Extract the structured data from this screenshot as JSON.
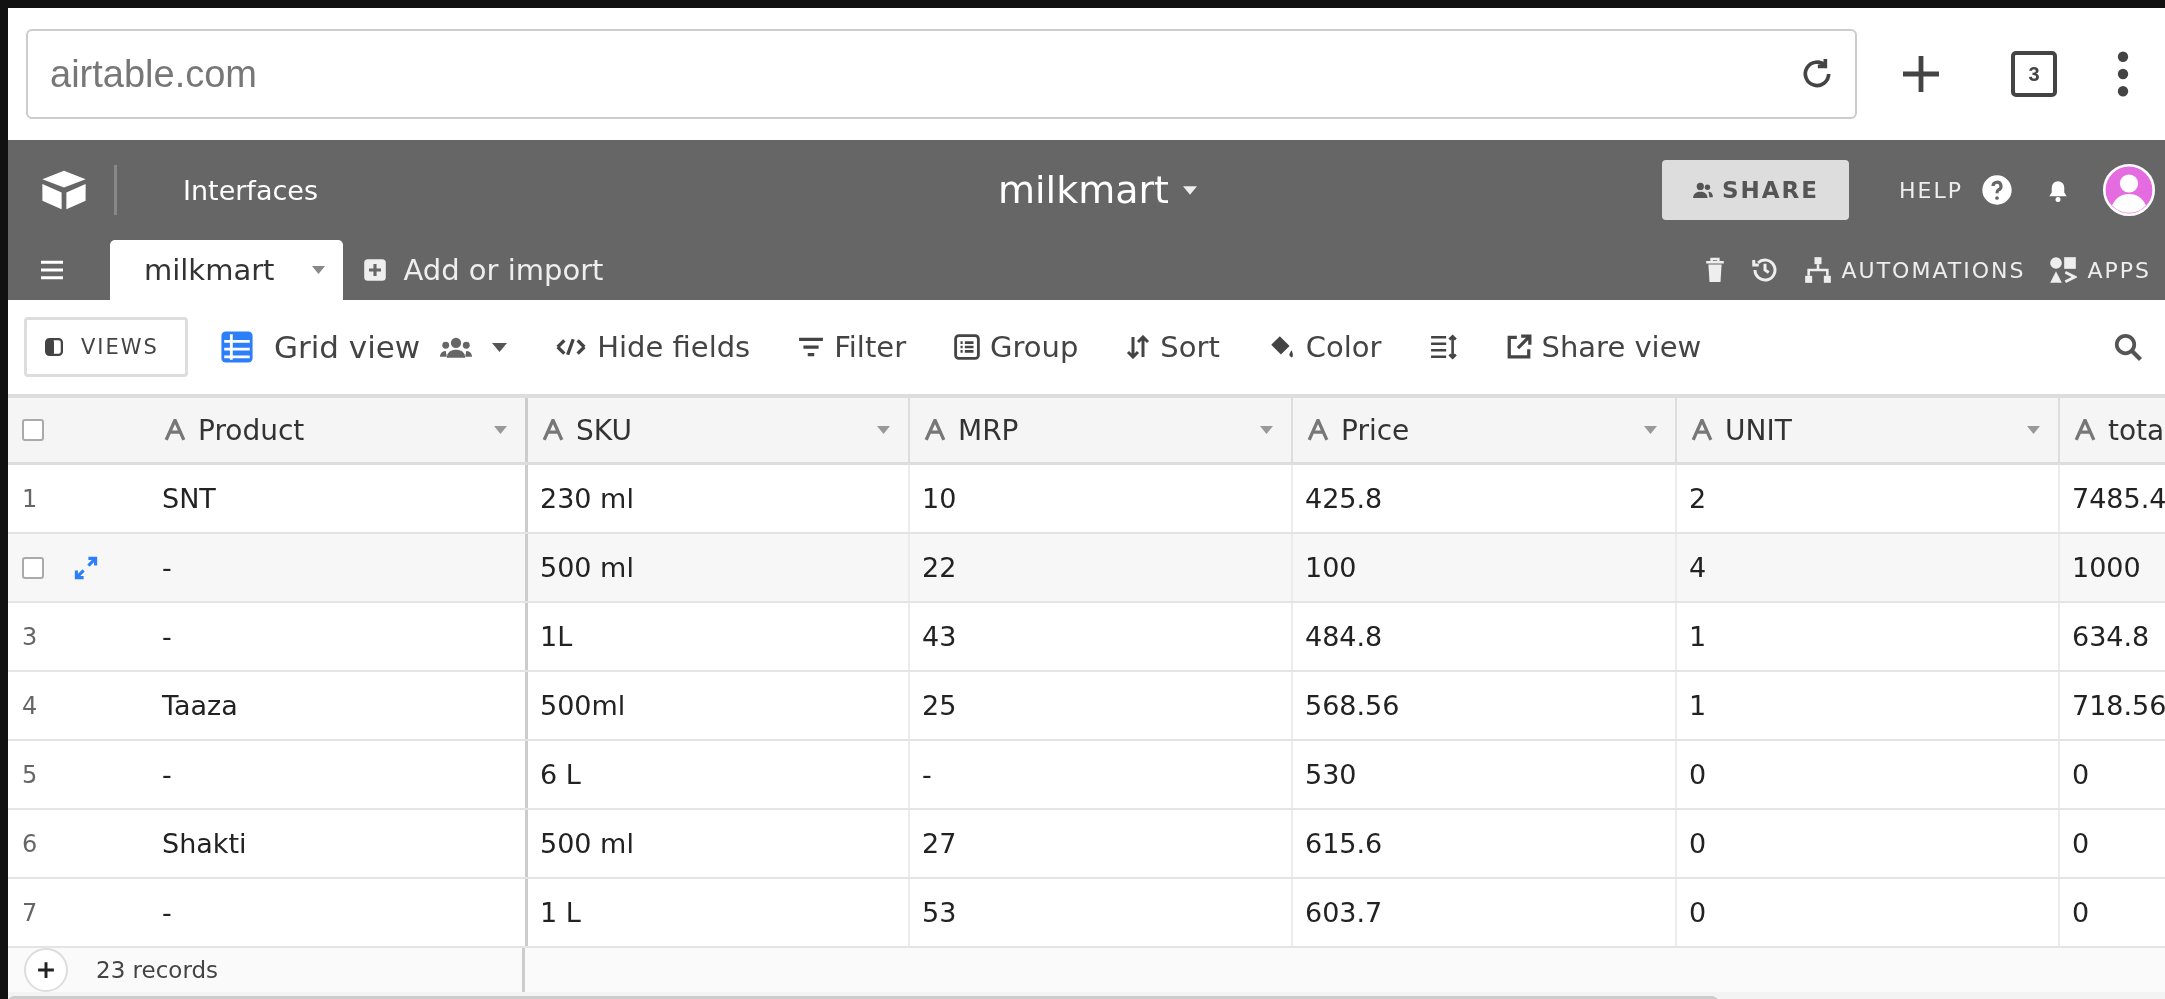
{
  "browser": {
    "url": "airtable.com",
    "tab_count": "3"
  },
  "app_bar": {
    "workspace_link": "Interfaces",
    "base_name": "milkmart",
    "share": "SHARE",
    "help": "HELP"
  },
  "table_tabs": [
    {
      "label": "milkmart",
      "selected": true
    }
  ],
  "add_import": "Add or import",
  "top_actions": {
    "automations": "AUTOMATIONS",
    "apps": "APPS"
  },
  "toolbar": {
    "views": "VIEWS",
    "view_name": "Grid view",
    "items": [
      {
        "kind": "hide",
        "label": "Hide fields"
      },
      {
        "kind": "filter",
        "label": "Filter"
      },
      {
        "kind": "group",
        "label": "Group"
      },
      {
        "kind": "sort",
        "label": "Sort"
      },
      {
        "kind": "color",
        "label": "Color"
      },
      {
        "kind": "row-height"
      },
      {
        "kind": "share",
        "label": "Share view"
      }
    ]
  },
  "select_all_checked": false,
  "columns": [
    "Product",
    "SKU",
    "MRP",
    "Price",
    "UNIT",
    "tota"
  ],
  "rows": [
    {
      "number": "1",
      "hovered": false,
      "checked": false,
      "cells": [
        "SNT",
        "230 ml",
        "10",
        "425.8",
        "2",
        "7485.4"
      ]
    },
    {
      "hovered": true,
      "checked": false,
      "cells": [
        "-",
        "500 ml",
        "22",
        "100",
        "4",
        "1000"
      ]
    },
    {
      "number": "3",
      "hovered": false,
      "checked": false,
      "cells": [
        "-",
        "1L",
        "43",
        "484.8",
        "1",
        "634.8"
      ]
    },
    {
      "number": "4",
      "hovered": false,
      "checked": false,
      "cells": [
        "Taaza",
        "500ml",
        "25",
        "568.56",
        "1",
        "718.56"
      ]
    },
    {
      "number": "5",
      "hovered": false,
      "checked": false,
      "cells": [
        "-",
        "6 L",
        "-",
        "530",
        "0",
        "0"
      ]
    },
    {
      "number": "6",
      "hovered": false,
      "checked": false,
      "cells": [
        "Shakti",
        "500 ml",
        "27",
        "615.6",
        "0",
        "0"
      ]
    },
    {
      "number": "7",
      "hovered": false,
      "checked": false,
      "cells": [
        "-",
        "1 L",
        "53",
        "603.7",
        "0",
        "0"
      ]
    }
  ],
  "footer": {
    "record_count": "23 records"
  }
}
